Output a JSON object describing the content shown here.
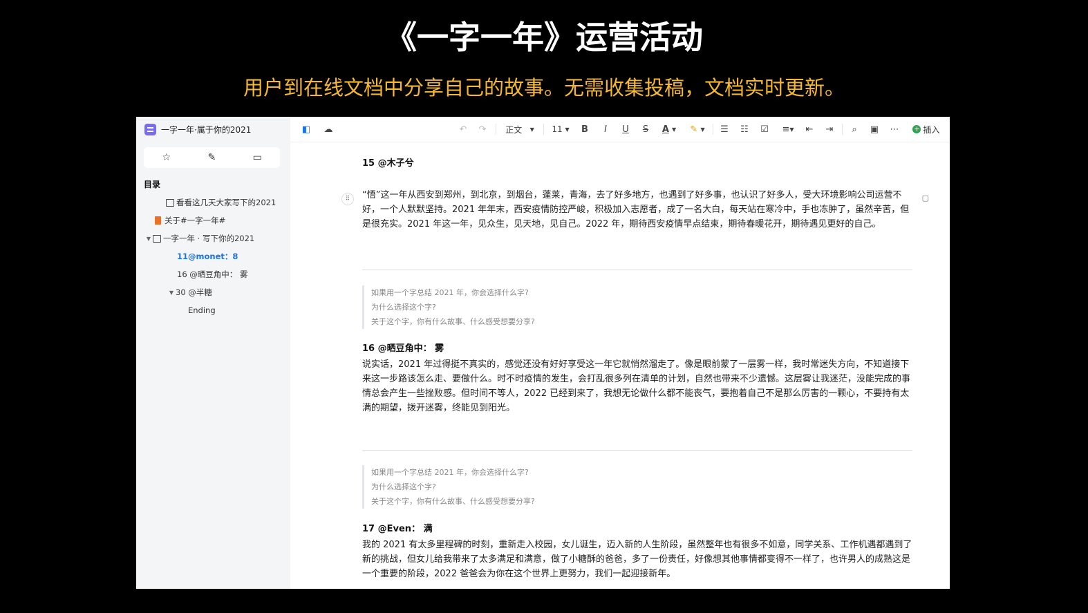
{
  "slide": {
    "title": "《一字一年》运营活动",
    "subtitle": "用户到在线文档中分享自己的故事。无需收集投稿，文档实时更新。"
  },
  "sidebar": {
    "doc_title": "一字一年·属于你的2021",
    "toc_heading": "目录",
    "toc": [
      {
        "label": "看看这几天大家写下的2021"
      },
      {
        "label": "关于#一字一年#"
      },
      {
        "label": "一字一年 · 写下你的2021"
      },
      {
        "label": "11@monet：8"
      },
      {
        "label": "16 @晒豆角中： 雾"
      },
      {
        "label": "30 @半糖"
      },
      {
        "label": "Ending"
      }
    ]
  },
  "toolbar": {
    "style": "正文",
    "font_size": "11",
    "insert_label": "插入"
  },
  "colors": {
    "accent": "#1a73e8",
    "subtitle": "#f5b82e",
    "doc_icon": "#7a6cf0",
    "insert_icon": "#2ea44f"
  },
  "content": {
    "entry15": {
      "heading": "15 @木子兮",
      "body": "“悟”这一年从西安到郑州，到北京，到烟台，蓬莱，青海，去了好多地方，也遇到了好多事，也认识了好多人，受大环境影响公司运营不好，一个人默默坚持。2021 年年末，西安疫情防控严峻，积极加入志愿者，成了一名大白，每天站在寒冷中，手也冻肿了，虽然辛苦，但是很充实。2021 年这一年，见众生，见天地，见自己。2022 年，期待西安疫情早点结束，期待春暖花开，期待遇见更好的自己。"
    },
    "quote1": [
      "如果用一个字总结 2021 年，你会选择什么字?",
      "为什么选择这个字?",
      "关于这个字，你有什么故事、什么感受想要分享?"
    ],
    "entry16": {
      "heading": "16 @晒豆角中： 雾",
      "body": "说实话，2021 年过得挺不真实的，感觉还没有好好享受这一年它就悄然溜走了。像是眼前蒙了一层雾一样，我时常迷失方向，不知道接下来这一步路该怎么走、要做什么。时不时疫情的发生，会打乱很多列在清单的计划，自然也带来不少遗憾。这层雾让我迷茫，没能完成的事情总会产生一些挫败感。但时间不等人，2022 已经到来了，我想无论做什么都不能丧气，要抱着自己不是那么厉害的一颗心，不要持有太满的期望，拨开迷雾，终能见到阳光。"
    },
    "quote2": [
      "如果用一个字总结 2021 年，你会选择什么字?",
      "为什么选择这个字?",
      "关于这个字，你有什么故事、什么感受想要分享?"
    ],
    "entry17": {
      "heading": "17 @Even： 满",
      "body": "我的 2021 有太多里程碑的时刻，重新走入校园，女儿诞生，迈入新的人生阶段，虽然整年也有很多不如意，同学关系、工作机遇都遇到了新的挑战，但女儿给我带来了太多满足和满意，做了小糖酥的爸爸，多了一份责任，好像想其他事情都变得不一样了，也许男人的成熟这是一个重要的阶段，2022 爸爸会为你在这个世界上更努力，我们一起迎接新年。"
    }
  }
}
